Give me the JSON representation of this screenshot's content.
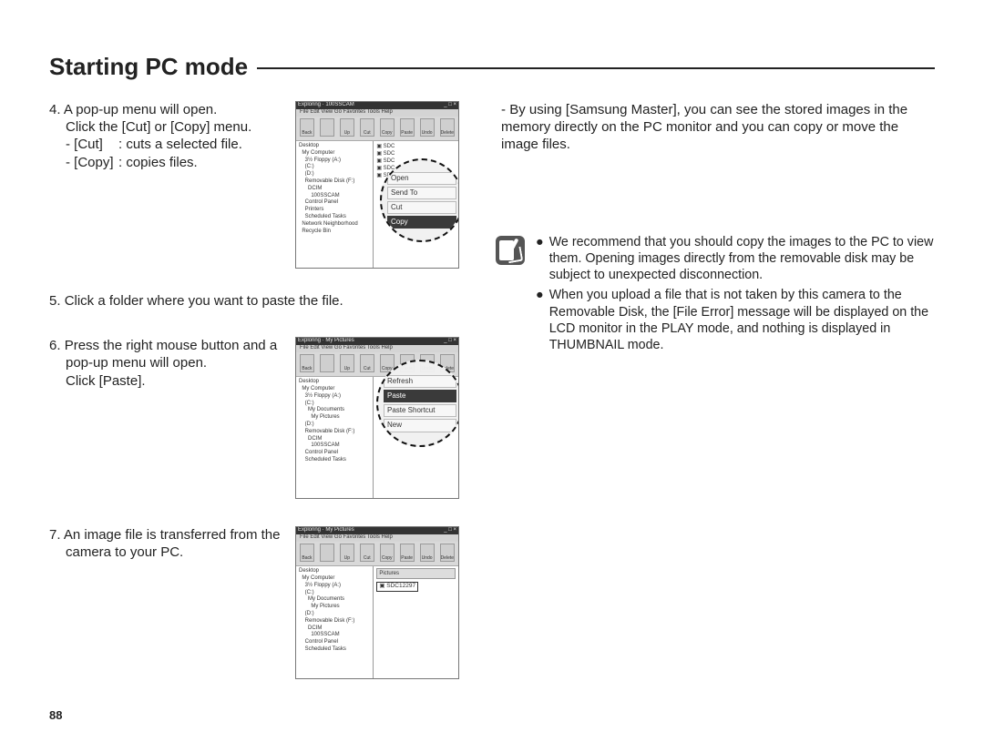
{
  "title": "Starting PC mode",
  "page_number": "88",
  "left": {
    "step4": {
      "num": "4.",
      "line1": "A pop-up menu will open.",
      "line2": "Click the [Cut] or [Copy] menu.",
      "cut_label": "- [Cut]",
      "cut_desc": ": cuts a selected file.",
      "copy_label": "- [Copy]",
      "copy_desc": ": copies files."
    },
    "step5": {
      "num": "5.",
      "text": "Click a folder where you want to paste the file."
    },
    "step6": {
      "num": "6.",
      "line1": "Press the right mouse button and a",
      "line2": "pop-up menu will open.",
      "line3": "Click [Paste]."
    },
    "step7": {
      "num": "7.",
      "line1": "An image file is transferred from the",
      "line2": "camera to your PC."
    }
  },
  "right": {
    "top": {
      "dash": "-",
      "text": "By using [Samsung Master], you can see the stored images in the memory directly on the PC monitor and you can copy or move the image files."
    },
    "note": {
      "bullet": "●",
      "item1": "We recommend that you should copy the images to the PC to view them. Opening images directly from the removable disk may be subject to unexpected disconnection.",
      "item2": "When you upload a file that is not taken by this camera to the Removable Disk, the [File Error] message will be displayed on the LCD monitor in the PLAY mode, and nothing is displayed in THUMBNAIL mode."
    }
  },
  "fig_common": {
    "titlebar_left": "Exploring",
    "titlebar_right": "_ □ ×",
    "menubar": "File  Edit  View  Go  Favorites  Tools  Help",
    "toolbar": [
      "Back",
      "",
      "Up",
      "Cut",
      "Copy",
      "Paste",
      "Undo",
      "Delete"
    ],
    "tree_lines": [
      "Desktop",
      "  My Computer",
      "    3½ Floppy (A:)",
      "    (C:)",
      "    (D:)",
      "    Removable Disk (F:)",
      "      DCIM",
      "        100SSCAM",
      "    Control Panel",
      "    Printers",
      "    Scheduled Tasks",
      "  Network Neighborhood",
      "  Recycle Bin"
    ]
  },
  "fig1": {
    "title_suffix": "100SSCAM",
    "pane_items": [
      "SDC",
      "SDC",
      "SDC",
      "SDC",
      "SDC"
    ],
    "menu": [
      "Open",
      "Send To",
      "Cut",
      "Copy"
    ],
    "menu_highlight_index": 3
  },
  "fig2": {
    "title_suffix": "My Pictures",
    "menu": [
      "Refresh",
      "Paste",
      "Paste Shortcut",
      "New"
    ],
    "menu_highlight_index": 1,
    "tree_override_lines": [
      "Desktop",
      "  My Computer",
      "    3½ Floppy (A:)",
      "    (C:)",
      "      My Documents",
      "        My Pictures",
      "    (D:)",
      "    Removable Disk (F:)",
      "      DCIM",
      "        100SSCAM",
      "    Control Panel",
      "    Scheduled Tasks"
    ]
  },
  "fig3": {
    "title_suffix": "My Pictures",
    "pane_header": "Pictures",
    "pane_item": "SDC12297",
    "tree_override_lines": [
      "Desktop",
      "  My Computer",
      "    3½ Floppy (A:)",
      "    (C:)",
      "      My Documents",
      "        My Pictures",
      "    (D:)",
      "    Removable Disk (F:)",
      "      DCIM",
      "        100SSCAM",
      "    Control Panel",
      "    Scheduled Tasks"
    ]
  }
}
